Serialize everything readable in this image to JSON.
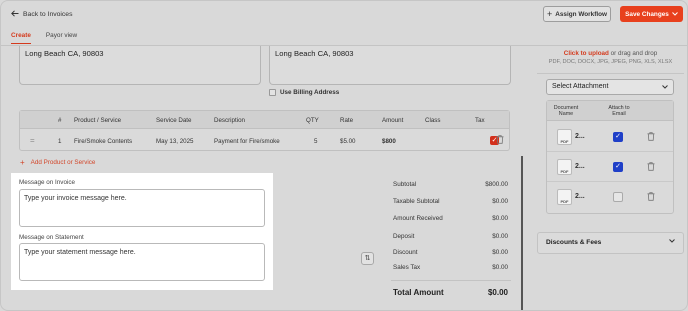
{
  "header": {
    "back_label": "Back to Invoices",
    "assign_label": "Assign Workflow",
    "save_label": "Save Changes"
  },
  "tabs": [
    {
      "label": "Create",
      "active": true
    },
    {
      "label": "Payor view",
      "active": false
    }
  ],
  "addresses": {
    "billing": "Long Beach CA, 90803",
    "shipping": "Long Beach CA, 90803",
    "use_billing_label": "Use Billing Address"
  },
  "line_items": {
    "columns": [
      "#",
      "Product / Service",
      "Service Date",
      "Description",
      "QTY",
      "Rate",
      "Amount",
      "Class",
      "Tax"
    ],
    "rows": [
      {
        "num": "1",
        "product": "Fire/Smoke Contents",
        "service_date": "May 13, 2025",
        "description": "Payment for Fire/smoke",
        "qty": "5",
        "rate": "$5.00",
        "amount": "$800",
        "class": "",
        "tax": true
      }
    ],
    "add_label": "Add Product or Service"
  },
  "messages": {
    "invoice_label": "Message on Invoice",
    "invoice_text": "Type your invoice message here.",
    "statement_label": "Message on Statement",
    "statement_text": "Type your statement message here."
  },
  "summary": {
    "rows": [
      {
        "label": "Subtotal",
        "value": "$800.00"
      },
      {
        "label": "Taxable Subtotal",
        "value": "$0.00"
      },
      {
        "label": "Amount Received",
        "value": "$0.00"
      },
      {
        "label": "Deposit",
        "value": "$0.00"
      },
      {
        "label": "Discount",
        "value": "$0.00"
      },
      {
        "label": "Sales Tax",
        "value": "$0.00"
      }
    ],
    "total_label": "Total Amount",
    "total_value": "$0.00"
  },
  "attachments": {
    "upload_link": "Click to upload",
    "upload_rest": "or drag and drop",
    "upload_types": "PDF, DOC, DOCX, JPG, JPEG, PNG, XLS, XLSX",
    "select_label": "Select Attachment",
    "head_document": "Document Name",
    "head_attach": "Attach to Email",
    "docs": [
      {
        "name": "2...",
        "type": "PDF",
        "attach": true
      },
      {
        "name": "2...",
        "type": "PDF",
        "attach": true
      },
      {
        "name": "2...",
        "type": "PDF",
        "attach": false
      }
    ]
  },
  "discounts": {
    "label": "Discounts & Fees"
  },
  "colors": {
    "accent": "#e8401d",
    "checkbox_blue": "#1f3fc8",
    "tax_red": "#d32f1b"
  }
}
